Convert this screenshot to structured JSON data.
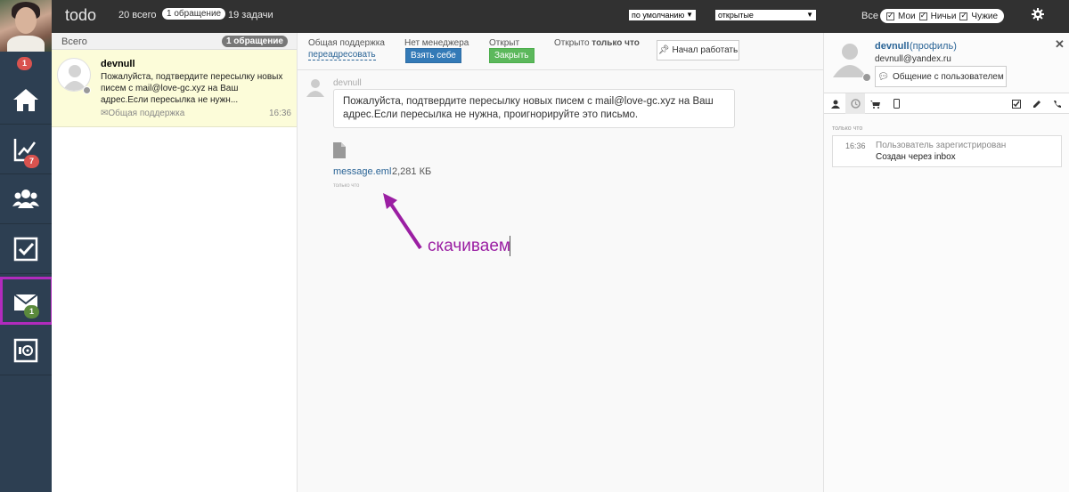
{
  "rail": {
    "avatar_badge": "1",
    "items": [
      {
        "icon": "home-icon"
      },
      {
        "icon": "chart-icon",
        "badge": "7"
      },
      {
        "icon": "users-icon"
      },
      {
        "icon": "checkbox-icon"
      },
      {
        "icon": "mail-icon",
        "badge": "1"
      },
      {
        "icon": "safe-icon"
      }
    ]
  },
  "topbar": {
    "title": "todo",
    "total": "20 всего",
    "requests": "1 обращение",
    "tasks": "19 задачи",
    "sort_select": "по умолчанию",
    "status_select": "открытые",
    "filter_all": "Все",
    "filter_mine": "Мои",
    "filter_nobody": "Ничьи",
    "filter_others": "Чужие"
  },
  "list": {
    "header_label": "Всего",
    "header_count": "1 обращение",
    "item": {
      "name": "devnull",
      "preview": "Пожалуйста, подтвердите пересылку новых писем с mail@love-gc.xyz на Ваш адрес.Если пересылка не нужн...",
      "group": "Общая поддержка",
      "time": "16:36"
    }
  },
  "conversation": {
    "group_label": "Общая поддержка",
    "reassign_link": "переадресовать",
    "manager_label": "Нет менеджера",
    "take_button": "Взять себе",
    "status_label": "Открыт",
    "close_button": "Закрыть",
    "opened_label": "Открыто",
    "opened_when": "только что",
    "start_work_button": "Начал работать",
    "message": {
      "author": "devnull",
      "text": "Пожалуйста, подтвердите пересылку новых писем с mail@love-gc.xyz на Ваш адрес.Если пересылка не нужна, проигнорируйте это письмо.",
      "attachment_name": "message.eml",
      "attachment_size": "2,281 КБ",
      "time": "только что"
    },
    "annotation": "скачиваем"
  },
  "profile": {
    "name": "devnull",
    "profile_link": "(профиль)",
    "email": "devnull@yandex.ru",
    "chat_button": "Общение с пользователем",
    "when": "только что",
    "event_time": "16:36",
    "event_title": "Пользователь зарегистрирован",
    "event_desc": "Создан через inbox"
  },
  "colors": {
    "rail_bg": "#2d3f52",
    "topbar_bg": "#313131",
    "highlight": "#b12bbd",
    "selected_row": "#fcfcd9",
    "primary_button": "#337ab7",
    "success_button": "#5cb85c",
    "badge_red": "#d9534f"
  }
}
